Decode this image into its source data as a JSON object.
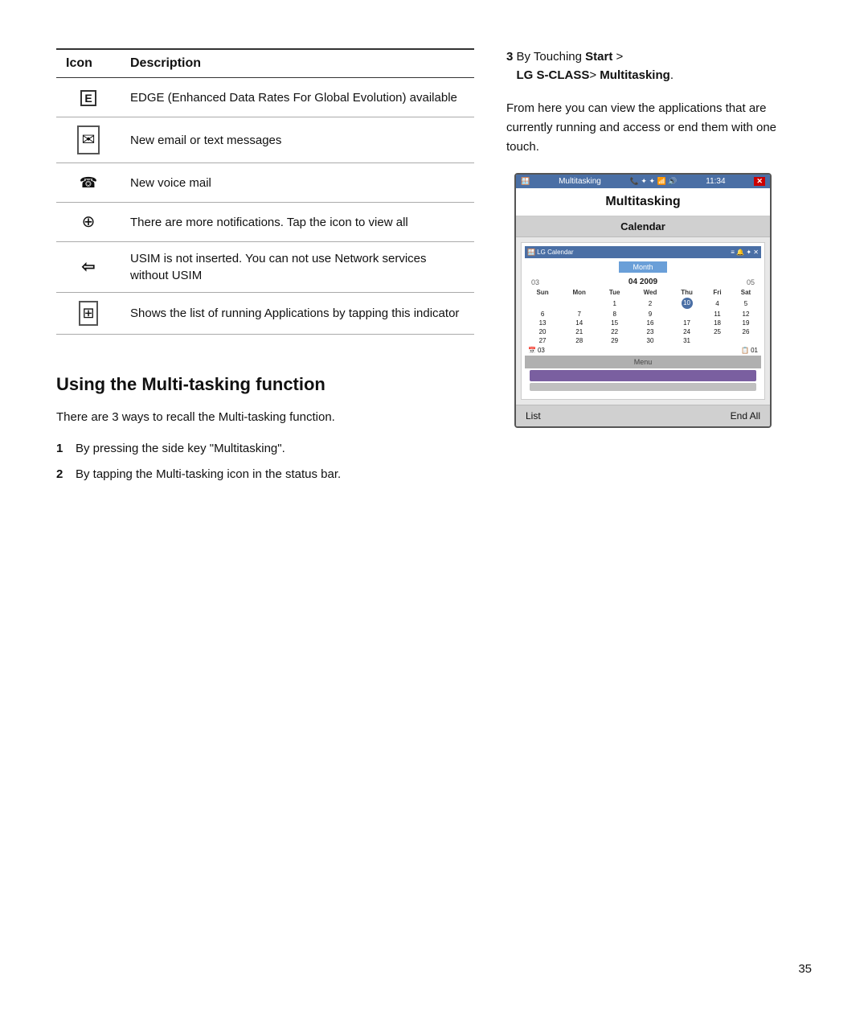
{
  "table": {
    "col_icon": "Icon",
    "col_desc": "Description",
    "rows": [
      {
        "icon_name": "edge-icon",
        "icon_symbol": "E",
        "icon_type": "edge",
        "description": "EDGE (Enhanced Data Rates For Global Evolution) available"
      },
      {
        "icon_name": "email-icon",
        "icon_symbol": "✉",
        "icon_type": "envelope",
        "description": "New email or text messages"
      },
      {
        "icon_name": "voicemail-icon",
        "icon_symbol": "☎",
        "icon_type": "voicemail",
        "description": "New voice mail"
      },
      {
        "icon_name": "notification-icon",
        "icon_symbol": "⊕",
        "icon_type": "notification",
        "description": "There are more notifications. Tap the icon to view all"
      },
      {
        "icon_name": "usim-icon",
        "icon_symbol": "⇦",
        "icon_type": "usim",
        "description": "USIM is not inserted. You can not use Network services without USIM"
      },
      {
        "icon_name": "multitask-app-icon",
        "icon_symbol": "⊞",
        "icon_type": "multitask",
        "description": "Shows the list of running Applications by tapping this indicator"
      }
    ]
  },
  "multitasking_section": {
    "title": "Using the Multi-tasking function",
    "intro": "There are 3 ways to recall the Multi-tasking function.",
    "steps": [
      {
        "num": "1",
        "text": "By pressing the side key \"Multitasking\"."
      },
      {
        "num": "2",
        "text": "By tapping the Multi-tasking icon in the status bar."
      }
    ]
  },
  "right_column": {
    "step3_num": "3",
    "step3_text": "By Touching ",
    "step3_bold1": "Start",
    "step3_gt": " > ",
    "step3_bold2": "LG S-CLASS",
    "step3_gt2": "> ",
    "step3_bold3": "Multitasking",
    "step3_period": ".",
    "from_here": "From here you can view the applications that are currently running and access or end them with one touch.",
    "phone": {
      "status_bar": "Multitasking",
      "status_time": "11:34",
      "title": "Multitasking",
      "app_title": "Calendar",
      "month_btn": "Month",
      "year": "04 2009",
      "prev_arrow": "03",
      "next_arrow": "05",
      "days_header": [
        "Sun",
        "Mon",
        "Tue",
        "Wed",
        "Thu",
        "Fri",
        "Sat"
      ],
      "week1": [
        "",
        "",
        "1",
        "2",
        "10",
        "4",
        "5"
      ],
      "week2": [
        "6",
        "7",
        "8",
        "9",
        "",
        "11",
        "12"
      ],
      "week3": [
        "13",
        "14",
        "15",
        "16",
        "17",
        "18",
        "19"
      ],
      "week4": [
        "20",
        "21",
        "22",
        "23",
        "24",
        "25",
        "26"
      ],
      "week5": [
        "27",
        "28",
        "29",
        "30",
        "31",
        "",
        ""
      ],
      "nav_left": "03",
      "nav_right": "01",
      "menu_label": "Menu",
      "bottom_list": "List",
      "bottom_end": "End All"
    }
  },
  "page_number": "35"
}
